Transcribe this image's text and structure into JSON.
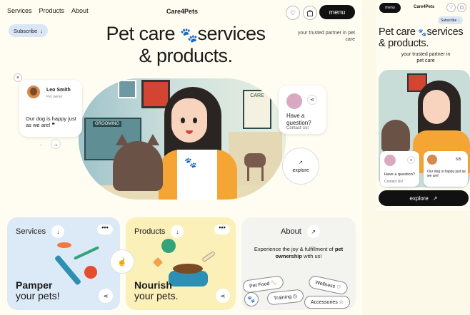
{
  "brand": "Care4Pets",
  "nav": [
    "Services",
    "Products",
    "About"
  ],
  "header": {
    "menu_label": "menu",
    "subscribe_label": "Subscribe",
    "icons": [
      "heart-icon",
      "bag-icon"
    ]
  },
  "hero": {
    "headline_line1": "Pet care",
    "headline_line1b": "services",
    "headline_line2": "& products.",
    "tagline": "your trusted partner in pet care",
    "grooming_sign": "GROOMING",
    "care_sign": "CARE",
    "paddock_sign": "PADDO",
    "explore_label": "explore"
  },
  "review": {
    "name": "Leo Smith",
    "role": "Pet owner",
    "quote": "Our dog is happy just as we are!",
    "count": "5/5"
  },
  "question": {
    "title": "Have a question?",
    "link": "Contact Us!"
  },
  "cards": {
    "services": {
      "title": "Services",
      "big": "Pamper",
      "small": "your pets!",
      "color": "#dce9f7"
    },
    "products": {
      "title": "Products",
      "big": "Nourish",
      "small": "your pets.",
      "color": "#fbf0b8"
    },
    "about": {
      "title": "About",
      "text_pre": "Experience the joy & fulfillment of",
      "text_bold": "pet ownership",
      "text_post": "with us!",
      "tags": [
        "Pet Food",
        "Wellness",
        "Training",
        "Accessories"
      ],
      "color": "#f3f3f0"
    }
  },
  "mobile": {
    "menu_label": "menu",
    "subscribe_label": "Subscribe",
    "headline_line1": "Pet care",
    "headline_line1b": "services",
    "headline_line2": "& products.",
    "tagline": "your trusted partner in pet care",
    "question_title": "Have a question?",
    "question_link": "Contact Us!",
    "review_count": "5/5",
    "review_quote": "Our dog is happy just as we are!",
    "explore_label": "explore"
  },
  "colors": {
    "background": "#fffdf2",
    "accent_orange": "#f2a14a",
    "dark": "#111111",
    "services_blue": "#dce9f7",
    "products_yellow": "#fbf0b8"
  }
}
